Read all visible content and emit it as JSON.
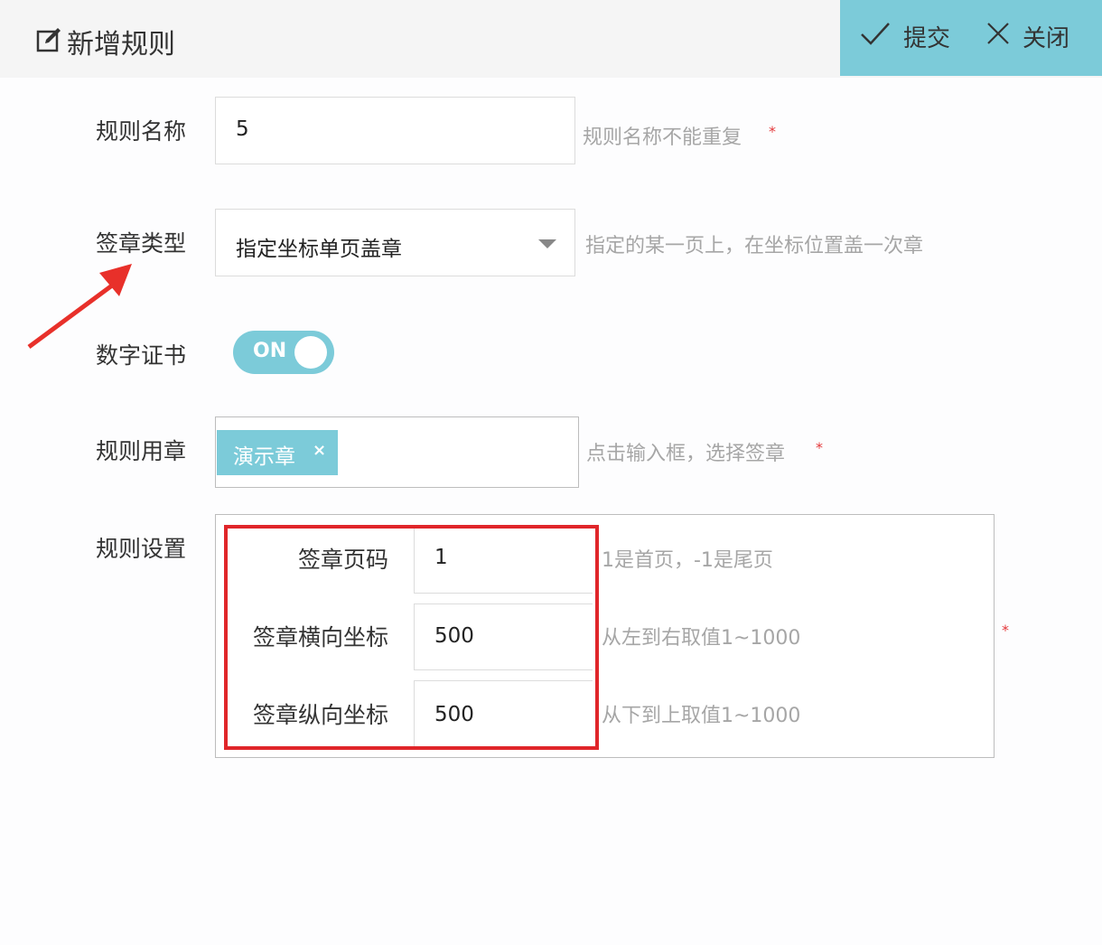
{
  "header": {
    "title": "新增规则",
    "submit_label": "提交",
    "close_label": "关闭"
  },
  "form": {
    "rule_name": {
      "label": "规则名称",
      "value": "5",
      "hint": "规则名称不能重复",
      "required": "*"
    },
    "seal_type": {
      "label": "签章类型",
      "value": "指定坐标单页盖章",
      "hint": "指定的某一页上，在坐标位置盖一次章"
    },
    "digital_cert": {
      "label": "数字证书",
      "toggle_text": "ON"
    },
    "rule_seal": {
      "label": "规则用章",
      "tag": "演示章",
      "tag_remove": "×",
      "hint": "点击输入框，选择签章",
      "required": "*"
    },
    "rule_settings": {
      "label": "规则设置",
      "required": "*",
      "page": {
        "label": "签章页码",
        "value": "1",
        "hint": "1是首页，-1是尾页"
      },
      "x": {
        "label": "签章横向坐标",
        "value": "500",
        "hint": "从左到右取值1~1000"
      },
      "y": {
        "label": "签章纵向坐标",
        "value": "500",
        "hint": "从下到上取值1~1000"
      }
    }
  },
  "colors": {
    "accent": "#7ccbd9",
    "highlight": "#e0262a",
    "annotation_arrow": "#e8302a"
  }
}
